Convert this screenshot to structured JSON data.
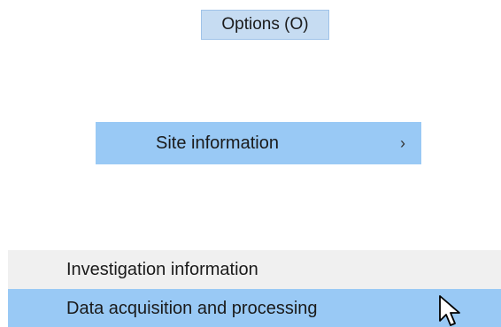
{
  "menubar": {
    "options_label": "Options (O)"
  },
  "submenu": {
    "site_information_label": "Site information",
    "submenu_arrow": "›"
  },
  "list": {
    "items": [
      {
        "label": "Investigation information",
        "state": "normal"
      },
      {
        "label": "Data acquisition and processing",
        "state": "selected"
      }
    ]
  },
  "colors": {
    "highlight": "#99c9f5",
    "menu_title_bg": "#c6dcf2",
    "menu_bg": "#f0f0f0"
  },
  "icons": {
    "cursor": "mouse-pointer-icon"
  }
}
